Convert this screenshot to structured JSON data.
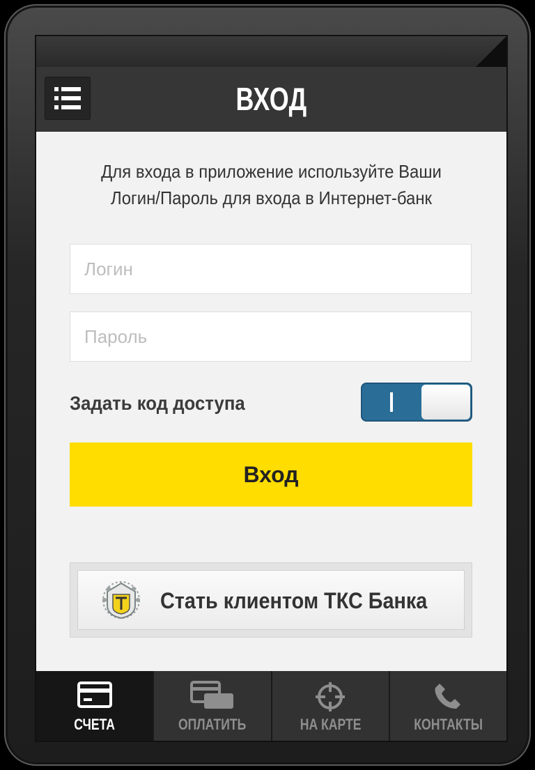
{
  "header": {
    "title": "ВХОД",
    "menu_icon": "menu-icon"
  },
  "intro": {
    "line1": "Для входа в приложение используйте Ваши",
    "line2": "Логин/Пароль для входа в Интернет-банк"
  },
  "form": {
    "login_placeholder": "Логин",
    "password_placeholder": "Пароль",
    "access_code_label": "Задать код доступа",
    "access_code_enabled": true,
    "submit_label": "Вход"
  },
  "become_client": {
    "label": "Стать клиентом ТКС Банка",
    "logo": "tks-bank-logo"
  },
  "tabs": [
    {
      "label": "СЧЕТА",
      "icon": "card-icon",
      "active": true
    },
    {
      "label": "ОПЛАТИТЬ",
      "icon": "pay-icon",
      "active": false
    },
    {
      "label": "НА КАРТЕ",
      "icon": "location-icon",
      "active": false
    },
    {
      "label": "КОНТАКТЫ",
      "icon": "phone-icon",
      "active": false
    }
  ],
  "colors": {
    "accent_yellow": "#ffdd00",
    "toggle_blue": "#2a6e98",
    "header_dark": "#363636"
  }
}
